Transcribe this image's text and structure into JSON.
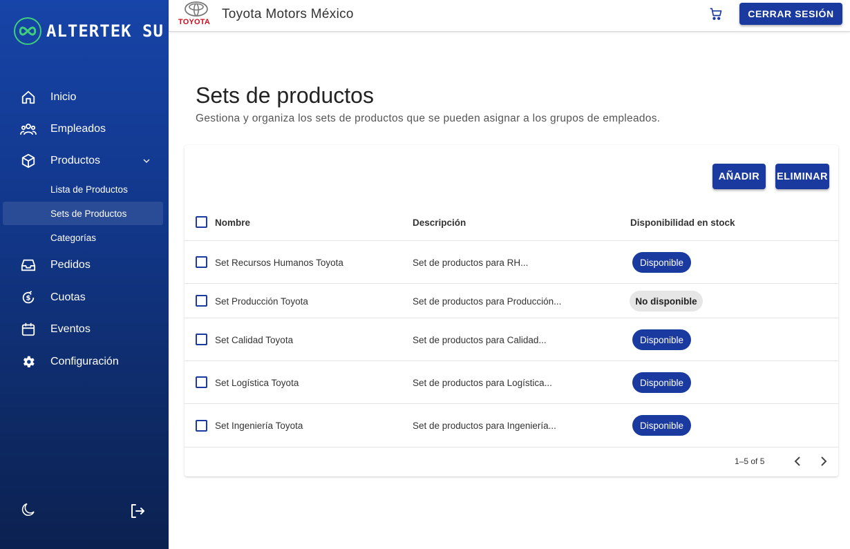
{
  "brand": {
    "name": "ALTERTEK SU",
    "accent": "#3fcf7a"
  },
  "sidebar": {
    "items": [
      {
        "label": "Inicio",
        "icon": "home-icon"
      },
      {
        "label": "Empleados",
        "icon": "people-icon"
      },
      {
        "label": "Productos",
        "icon": "box-icon"
      },
      {
        "label": "Pedidos",
        "icon": "inbox-icon"
      },
      {
        "label": "Cuotas",
        "icon": "currency-cycle-icon"
      },
      {
        "label": "Eventos",
        "icon": "calendar-icon"
      },
      {
        "label": "Configuración",
        "icon": "gear-icon"
      }
    ],
    "sub_items": [
      {
        "label": "Lista de Productos"
      },
      {
        "label": "Sets de Productos"
      },
      {
        "label": "Categorías"
      }
    ],
    "bottom_icons": [
      "moon-icon",
      "logout-icon"
    ]
  },
  "topbar": {
    "logo_text": "TOYOTA",
    "company": "Toyota Motors México",
    "logout_label": "CERRAR SESIÓN"
  },
  "page": {
    "title": "Sets de productos",
    "subtitle": "Gestiona y organiza los sets de productos que se pueden asignar a los grupos de empleados."
  },
  "actions": {
    "add_label": "AÑADIR",
    "delete_label": "ELIMINAR"
  },
  "table": {
    "headers": {
      "name": "Nombre",
      "description": "Descripción",
      "stock": "Disponibilidad en stock"
    },
    "rows": [
      {
        "name": "Set Recursos Humanos Toyota",
        "description": "Set de productos para RH...",
        "stock": "Disponible"
      },
      {
        "name": "Set Producción Toyota",
        "description": "Set de productos para Producción...",
        "stock": "No disponible"
      },
      {
        "name": "Set Calidad Toyota",
        "description": "Set de productos para Calidad...",
        "stock": "Disponible"
      },
      {
        "name": "Set Logística Toyota",
        "description": "Set de productos para Logística...",
        "stock": "Disponible"
      },
      {
        "name": "Set Ingeniería Toyota",
        "description": "Set de productos para Ingeniería...",
        "stock": "Disponible"
      }
    ],
    "pagination": "1–5 of 5"
  },
  "colors": {
    "primary": "#1a3aa0",
    "toyota_red": "#cc1020"
  }
}
